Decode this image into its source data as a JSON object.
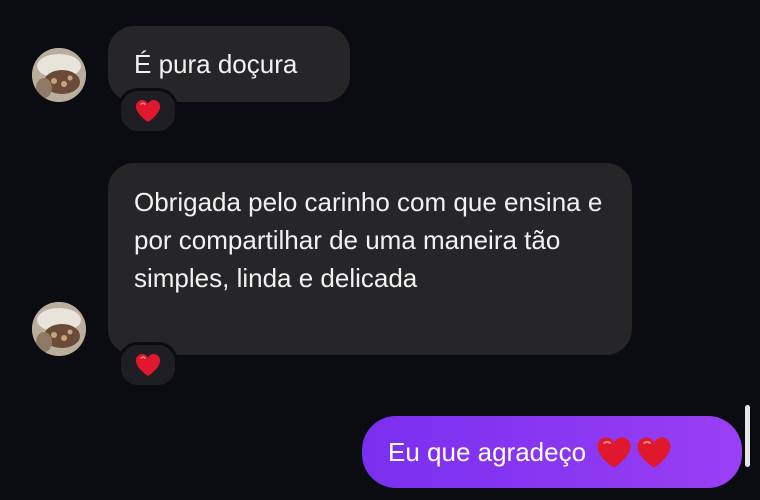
{
  "messages": [
    {
      "direction": "incoming",
      "text": "É pura doçura",
      "reaction": "heart-icon"
    },
    {
      "direction": "incoming",
      "text": "Obrigada pelo carinho com que ensina e por compartilhar de uma maneira tão simples, linda e delicada",
      "reaction": "heart-icon"
    },
    {
      "direction": "outgoing",
      "text": "Eu que agradeço",
      "trailing_icons": [
        "heart-icon",
        "heart-icon"
      ]
    }
  ],
  "colors": {
    "background": "#0b0b12",
    "incoming_bubble": "#262629",
    "outgoing_bubble": "#8a37f2",
    "heart": "#e0182d"
  }
}
